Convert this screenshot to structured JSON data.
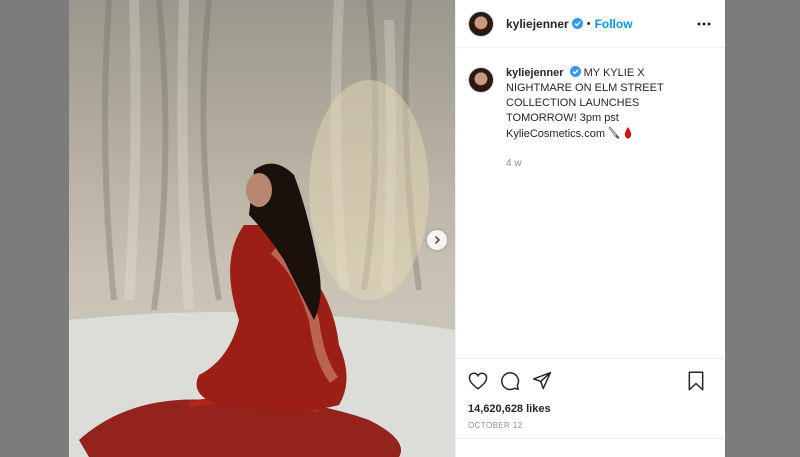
{
  "post": {
    "author": {
      "username": "kyliejenner",
      "verified": true,
      "follow_label": "Follow",
      "separator": "•"
    },
    "caption": {
      "username": "kyliejenner",
      "text": "MY KYLIE X NIGHTMARE ON ELM STREET COLLECTION LAUNCHES TOMORROW! 3pm pst KylieCosmetics.com",
      "emojis": [
        "knife-emoji",
        "blood-drop-emoji"
      ],
      "time": "4 w"
    },
    "likes": "14,620,628 likes",
    "date": "OCTOBER 12",
    "icons": {
      "like": "heart-icon",
      "comment": "comment-icon",
      "share": "share-icon",
      "save": "bookmark-icon",
      "more": "more-options-icon",
      "next": "chevron-right-icon"
    }
  },
  "colors": {
    "link_blue": "#0095f6",
    "verified_blue": "#3897f0",
    "text": "#262626",
    "muted": "#8e8e8e",
    "border": "#efefef"
  }
}
